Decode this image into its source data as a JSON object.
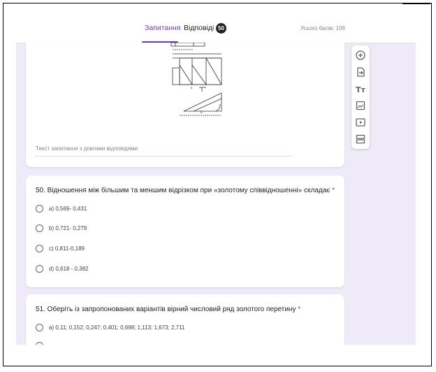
{
  "header": {
    "tab_questions": "Запитання",
    "tab_answers": "Відповіді",
    "answers_count": "50",
    "total_points": "Усього балів: 106"
  },
  "question_prev": {
    "answer_placeholder": "Текст запитання з довгими відповідями"
  },
  "question_50": {
    "title": "50. Відношення між більшим та меншим відрізком при «золотому співвідношенні» складає",
    "required_mark": "*",
    "options": [
      "a) 0,569- 0,431",
      "b) 0,721- 0,279",
      "c) 0,811-0,189",
      "d) 0,618 - 0,382"
    ]
  },
  "question_51": {
    "title": "51. Оберіть із запропонованих варіантів вірний числовий ряд золотого перетину",
    "required_mark": "*",
    "options": [
      "a) 0,11; 0,152; 0,247; 0,401; 0,698; 1,113; 1,673; 2,711"
    ]
  },
  "toolbar": {
    "icons": [
      "add-question-icon",
      "import-questions-icon",
      "add-title-icon",
      "add-image-icon",
      "add-video-icon",
      "add-section-icon"
    ],
    "title_icon_text": "Tт"
  },
  "colors": {
    "accent": "#673ab7",
    "background": "#efeaf7",
    "required": "#d93025"
  }
}
